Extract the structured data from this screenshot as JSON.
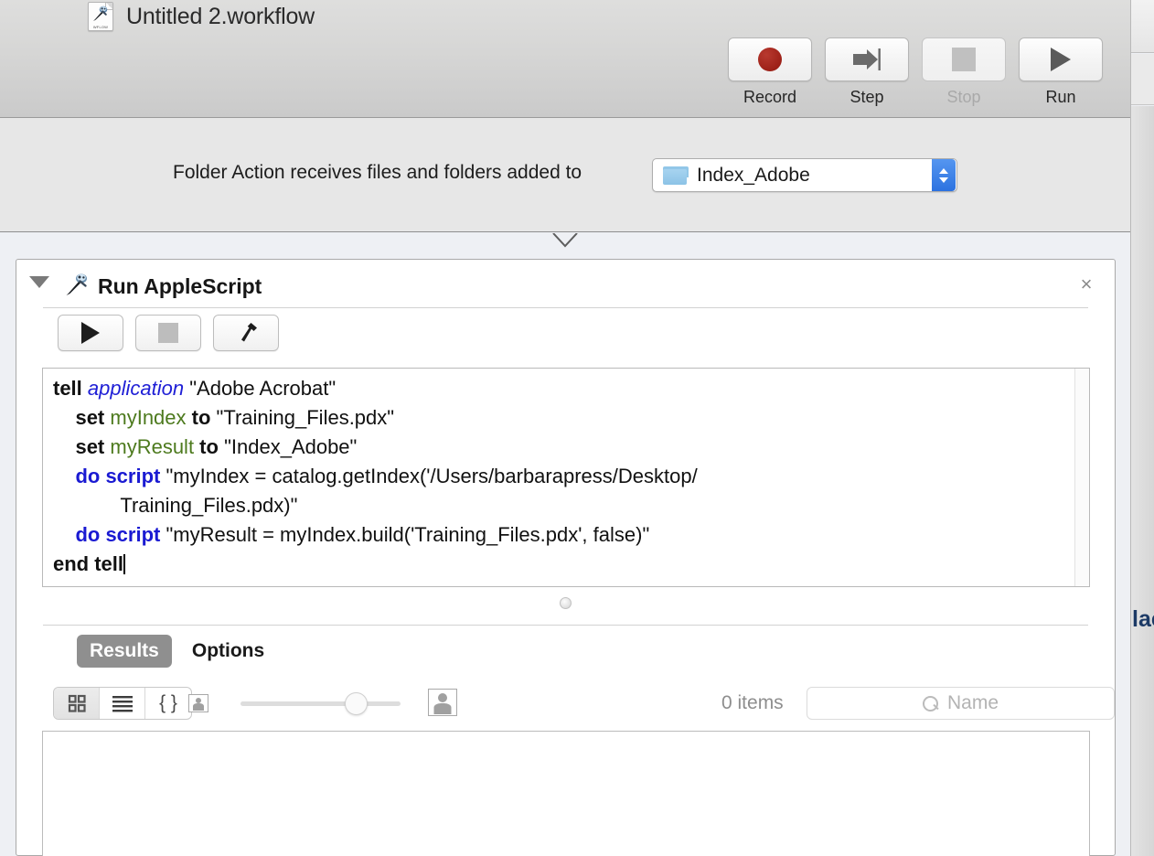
{
  "window": {
    "document_title": "Untitled 2.workflow",
    "document_icon": "workflow-document-icon",
    "icon_badge_text": "WFLOW"
  },
  "toolbar": {
    "buttons": [
      {
        "label": "Record",
        "icon": "record-circle-icon",
        "enabled": true
      },
      {
        "label": "Step",
        "icon": "step-forward-icon",
        "enabled": true
      },
      {
        "label": "Stop",
        "icon": "stop-square-icon",
        "enabled": false
      },
      {
        "label": "Run",
        "icon": "play-triangle-icon",
        "enabled": true
      }
    ]
  },
  "folder_action": {
    "prompt": "Folder Action receives files and folders added to",
    "popup": {
      "selected": "Index_Adobe",
      "icon": "folder-icon",
      "options": [
        "Index_Adobe"
      ]
    }
  },
  "action": {
    "title": "Run AppleScript",
    "icon": "applescript-icon",
    "disclosure": "disclosure-triangle-open",
    "close": "×",
    "script_toolbar": [
      {
        "name": "run",
        "icon": "play-triangle-icon",
        "enabled": true
      },
      {
        "name": "stop",
        "icon": "stop-square-icon",
        "enabled": false
      },
      {
        "name": "compile",
        "icon": "hammer-icon",
        "enabled": true
      }
    ],
    "script": {
      "lines": [
        [
          {
            "t": "tell ",
            "c": "kw"
          },
          {
            "t": "application ",
            "c": "app"
          },
          {
            "t": "\"Adobe Acrobat\"",
            "c": "str"
          }
        ],
        [
          {
            "t": "    set ",
            "c": "kw"
          },
          {
            "t": "myIndex ",
            "c": "var"
          },
          {
            "t": "to ",
            "c": "kw"
          },
          {
            "t": "\"Training_Files.pdx\"",
            "c": "str"
          }
        ],
        [
          {
            "t": "    set ",
            "c": "kw"
          },
          {
            "t": "myResult ",
            "c": "var"
          },
          {
            "t": "to ",
            "c": "kw"
          },
          {
            "t": "\"Index_Adobe\"",
            "c": "str"
          }
        ],
        [
          {
            "t": "    do script ",
            "c": "blu"
          },
          {
            "t": "\"myIndex = catalog.getIndex('/Users/barbarapress/Desktop/",
            "c": "str"
          }
        ],
        [
          {
            "t": "            Training_Files.pdx)\"",
            "c": "str"
          }
        ],
        [
          {
            "t": "    do script ",
            "c": "blu"
          },
          {
            "t": "\"myResult = myIndex.build('Training_Files.pdx', false)\"",
            "c": "str"
          }
        ],
        [
          {
            "t": "end tell",
            "c": "kw"
          },
          {
            "t": "",
            "c": "caret"
          }
        ]
      ]
    },
    "tabs": [
      {
        "label": "Results",
        "active": true
      },
      {
        "label": "Options",
        "active": false
      }
    ],
    "results_toolbar": {
      "view_modes": [
        {
          "name": "icon-view",
          "icon": "grid-icon",
          "active": true
        },
        {
          "name": "list-view",
          "icon": "list-icon",
          "active": false
        },
        {
          "name": "code-view",
          "icon": "braces-icon",
          "active": false,
          "text": "{ }"
        }
      ],
      "size_slider": {
        "min_icon": "small-person-icon",
        "max_icon": "large-person-icon",
        "value_percent": 65
      },
      "item_count": "0 items",
      "search": {
        "placeholder": "Name",
        "value": "",
        "icon": "search-icon"
      }
    }
  },
  "right_panel": {
    "clipped_text": "lac"
  },
  "colors": {
    "accent_blue": "#2c72e0",
    "record_red": "#9b1f16",
    "keyword_blue": "#1a1ad2",
    "variable_green": "#4d7a1e",
    "tab_active_bg": "#8f8f8f"
  }
}
